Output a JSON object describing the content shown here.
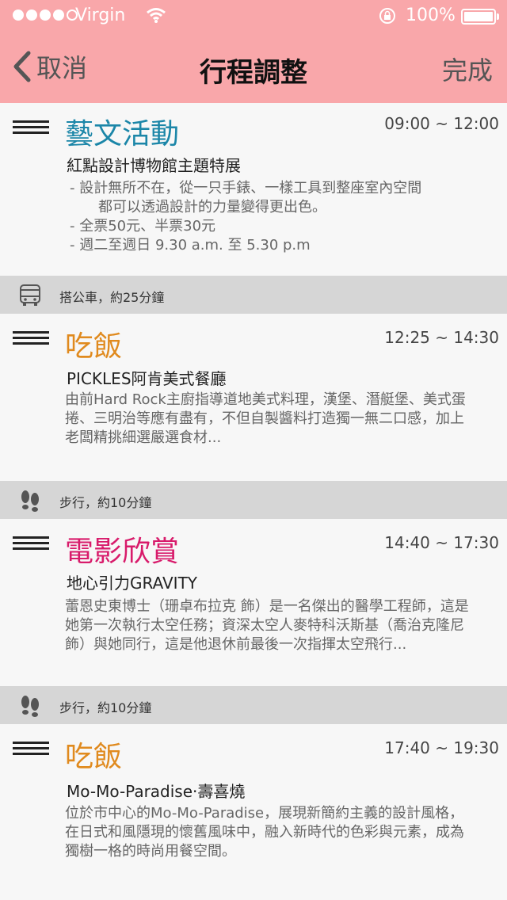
{
  "status_bar": {
    "carrier": "Virgin",
    "battery": "100%"
  },
  "nav": {
    "back_label": "取消",
    "title": "行程調整",
    "done_label": "完成"
  },
  "colors": {
    "header_bg": "#f9a7aa",
    "arts": "#1b86a8",
    "food": "#e08a1e",
    "movie": "#d81b6b"
  },
  "items": [
    {
      "category": "藝文活動",
      "time": "09:00 ~ 12:00",
      "place": "紅點設計博物館主題特展",
      "bullets": [
        "- 設計無所不在，從一只手錶、一樣工具到整座室內空間",
        "都可以透過設計的力量變得更出色。",
        "- 全票50元、半票30元",
        "- 週二至週日 9.30 a.m. 至 5.30 p.m"
      ]
    },
    {
      "category": "吃飯",
      "time": "12:25 ~ 14:30",
      "place": "PICKLES阿肯美式餐廳",
      "desc": "由前Hard Rock主廚指導道地美式料理，漢堡、潛艇堡、美式蛋捲、三明治等應有盡有，不但自製醬料打造獨一無二口感，加上老闆精挑細選嚴選食材..."
    },
    {
      "category": "電影欣賞",
      "time": "14:40 ~ 17:30",
      "place": "地心引力GRAVITY",
      "desc": "蕾恩史東博士（珊卓布拉克 飾）是一名傑出的醫學工程師，這是她第一次執行太空任務；資深太空人麥特科沃斯基（喬治克隆尼 飾）與她同行，這是他退休前最後一次指揮太空飛行..."
    },
    {
      "category": "吃飯",
      "time": "17:40 ~ 19:30",
      "place": "Mo-Mo-Paradise·壽喜燒",
      "desc": "位於市中心的Mo-Mo-Paradise，展現新簡約主義的設計風格，在日式和風隱現的懷舊風味中，融入新時代的色彩與元素，成為獨樹一格的時尚用餐空間。"
    }
  ],
  "transits": [
    {
      "icon": "bus-icon",
      "text": "搭公車，約25分鐘"
    },
    {
      "icon": "footsteps-icon",
      "text": "步行，約10分鐘"
    },
    {
      "icon": "footsteps-icon",
      "text": "步行，約10分鐘"
    }
  ]
}
